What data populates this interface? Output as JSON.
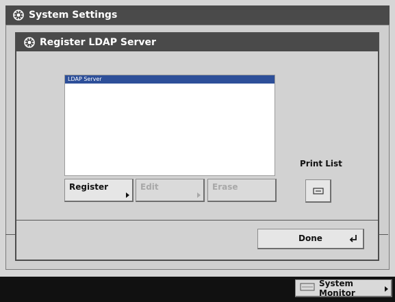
{
  "window": {
    "title": "System Settings",
    "icon": "settings-gear-icon"
  },
  "dialog": {
    "title": "Register LDAP Server",
    "icon": "settings-gear-icon"
  },
  "list": {
    "header": "LDAP Server",
    "items": []
  },
  "buttons": {
    "register": "Register",
    "edit": "Edit",
    "erase": "Erase",
    "print_list_label": "Print List",
    "print_icon": "printer-icon",
    "done": "Done"
  },
  "status_bar": {
    "system_monitor": "System Monitor"
  },
  "colors": {
    "title_bar": "#4a4a4a",
    "list_header": "#2d4f99",
    "status_bar": "#111111"
  }
}
